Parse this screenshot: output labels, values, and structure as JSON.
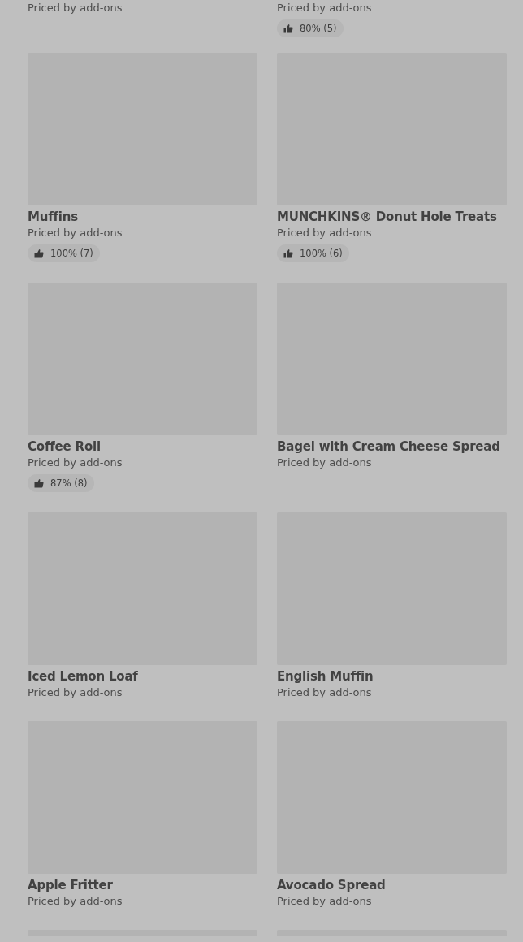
{
  "items": [
    {
      "kind": "tail",
      "price": "Priced by add-ons"
    },
    {
      "kind": "tail",
      "price": "Priced by add-ons",
      "rating": "80% (5)"
    },
    {
      "kind": "full",
      "name": "Muffins",
      "price": "Priced by add-ons",
      "rating": "100% (7)"
    },
    {
      "kind": "full",
      "name": "MUNCHKINS® Donut Hole Treats",
      "price": "Priced by add-ons",
      "rating": "100% (6)"
    },
    {
      "kind": "full",
      "name": "Coffee Roll",
      "price": "Priced by add-ons",
      "rating": "87% (8)"
    },
    {
      "kind": "full",
      "name": "Bagel with Cream Cheese Spread",
      "price": "Priced by add-ons"
    },
    {
      "kind": "full",
      "name": "Iced Lemon Loaf",
      "price": "Priced by add-ons"
    },
    {
      "kind": "full",
      "name": "English Muffin",
      "price": "Priced by add-ons"
    },
    {
      "kind": "full",
      "name": "Apple Fritter",
      "price": "Priced by add-ons"
    },
    {
      "kind": "full",
      "name": "Avocado Spread",
      "price": "Priced by add-ons"
    },
    {
      "kind": "head"
    },
    {
      "kind": "head"
    }
  ]
}
